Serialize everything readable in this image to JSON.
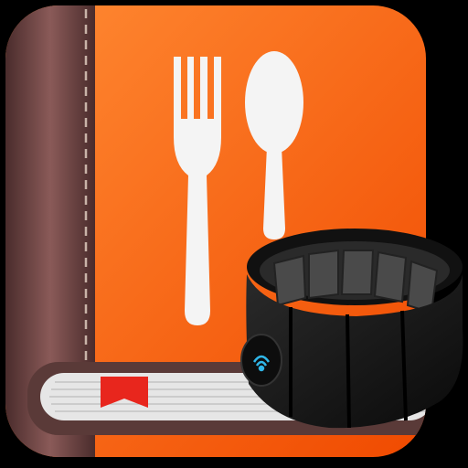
{
  "icon": {
    "colors": {
      "background": "#000000",
      "cover_orange_light": "#ff8a33",
      "cover_orange_dark": "#f04a00",
      "spine_brown_light": "#8a5a58",
      "spine_brown_dark": "#4a2c2c",
      "stitch": "#c9b3a8",
      "utensil": "#f4f4f4",
      "pages": "#e6e6e6",
      "bookmark": "#e8261d",
      "band_body": "#1a1a1a",
      "band_segment": "#4a4a4a",
      "band_logo": "#2fb6e8"
    },
    "symbols": [
      "fork-icon",
      "spoon-icon",
      "bookmark-icon",
      "myo-armband-icon"
    ]
  }
}
